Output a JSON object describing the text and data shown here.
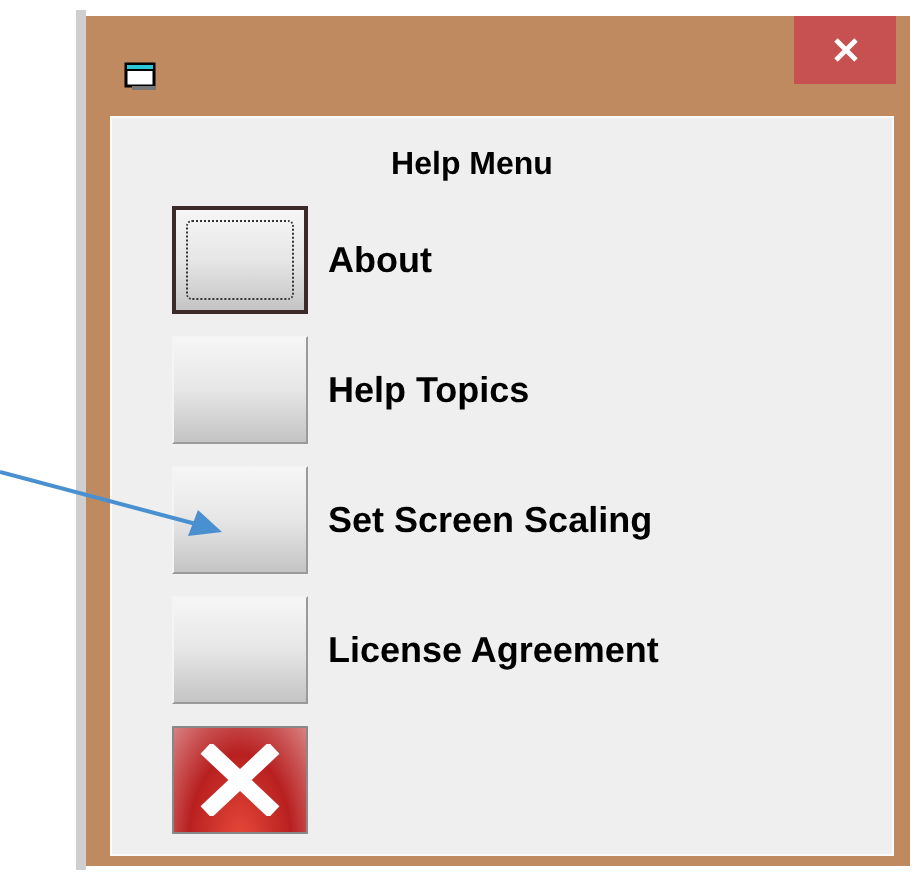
{
  "dialog": {
    "heading": "Help Menu",
    "items": [
      {
        "label": "About",
        "focused": true
      },
      {
        "label": "Help Topics",
        "focused": false
      },
      {
        "label": "Set Screen Scaling",
        "focused": false
      },
      {
        "label": "License Agreement",
        "focused": false
      }
    ]
  }
}
